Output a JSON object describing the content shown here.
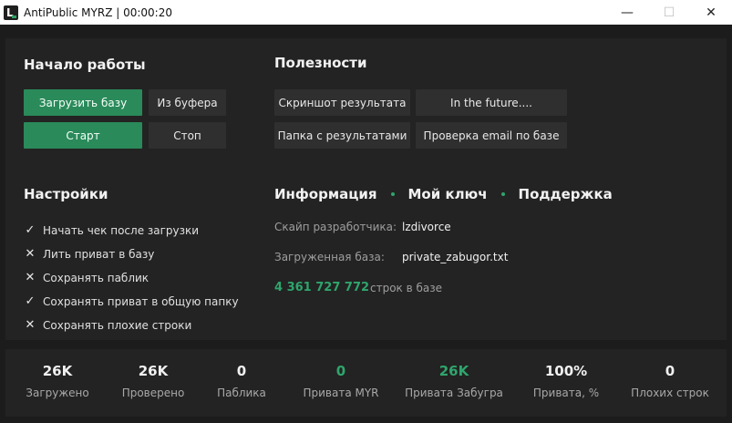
{
  "window": {
    "title": "AntiPublic MYRZ | 00:00:20",
    "controls": [
      "minimize-icon",
      "maximize-icon",
      "close-icon"
    ]
  },
  "start_section": {
    "title": "Начало работы",
    "load_base": "Загрузить базу",
    "from_buffer": "Из буфера",
    "start": "Старт",
    "stop": "Стоп"
  },
  "utilities": {
    "title": "Полезности",
    "screenshot": "Скриншот результата",
    "future": "In the future....",
    "results_folder": "Папка с результатами",
    "email_check": "Проверка email по базе"
  },
  "settings": {
    "title": "Настройки",
    "options": [
      {
        "label": "Начать чек после загрузки",
        "checked": true
      },
      {
        "label": "Лить приват в базу",
        "checked": false
      },
      {
        "label": "Сохранять паблик",
        "checked": false
      },
      {
        "label": "Сохранять приват в общую папку",
        "checked": true
      },
      {
        "label": "Сохранять плохие строки",
        "checked": false
      }
    ]
  },
  "info": {
    "nav": [
      "Информация",
      "Мой ключ",
      "Поддержка"
    ],
    "skype_label": "Скайп разработчика:",
    "skype_value": "lzdivorce",
    "base_label": "Загруженная база:",
    "base_value": "private_zabugor.txt",
    "row_count": "4 361 727 772",
    "row_count_suffix": "строк в базе"
  },
  "stats": [
    {
      "value": "26K",
      "label": "Загружено"
    },
    {
      "value": "26K",
      "label": "Проверено"
    },
    {
      "value": "0",
      "label": "Паблика"
    },
    {
      "value": "0",
      "label": "Привата MYR"
    },
    {
      "value": "26K",
      "label": "Привата Забугра"
    },
    {
      "value": "100%",
      "label": "Привата, %"
    },
    {
      "value": "0",
      "label": "Плохих строк"
    }
  ],
  "colors": {
    "accent": "#2fa56c",
    "button_green": "#2a8a5a",
    "panel": "#232323",
    "background": "#1c1c1c"
  }
}
